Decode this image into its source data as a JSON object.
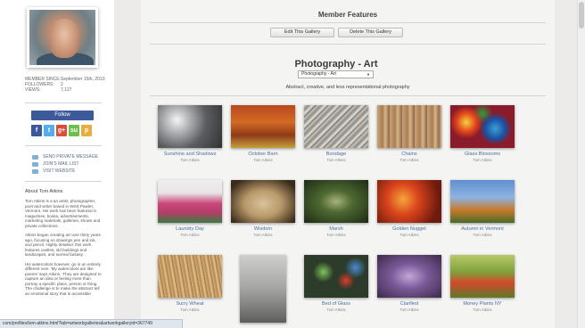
{
  "profile": {
    "stats": [
      {
        "label": "MEMBER SINCE:",
        "value": "September 15th, 2013"
      },
      {
        "label": "FOLLOWERS:",
        "value": "2"
      },
      {
        "label": "VIEWS:",
        "value": "7,127"
      }
    ],
    "follow_label": "Follow",
    "social": [
      {
        "icon": "facebook-icon",
        "glyph": "f",
        "color": "#3b5998"
      },
      {
        "icon": "twitter-icon",
        "glyph": "t",
        "color": "#55acee"
      },
      {
        "icon": "googleplus-icon",
        "glyph": "g+",
        "color": "#dd4b39"
      },
      {
        "icon": "stumbleupon-icon",
        "glyph": "su",
        "color": "#6fbf4c"
      },
      {
        "icon": "pinterest-icon",
        "glyph": "p",
        "color": "#e8ad3f"
      }
    ],
    "links": [
      "SEND PRIVATE MESSAGE",
      "JOIN'S MAIL LIST",
      "VISIT WEBSITE"
    ],
    "about_title": "About Tom Atkins",
    "about_paragraphs": [
      "Tom Atkins is a an artist, photographer, poet and writer based in West Pawlet, Vermont. His work has been featured in magazines, books, advertisements, marketing materials, galleries, shows and private collections.",
      "Atkins began creating art over thirty years ago, focusing on drawings pen and ink, and pencil. Highly detailed, this work features castles, old buildings and landscapes, and surreal fantasy.",
      "His watercolors however, go in an entirely different vein. 'My watercolors are like poems' says Atkins. 'They are designed to capture an idea or feeling more than portray a specific place, person or thing. The challenge is to make the abstract tell an emotional story that is accessible"
    ]
  },
  "main": {
    "section_title": "Member Features",
    "edit_button": "Edit This Gallery",
    "delete_button": "Delete This Gallery",
    "gallery_title": "Photography - Art",
    "gallery_select_value": "Photography - Art",
    "gallery_description": "Abstract, creative, and less representational photography",
    "artworks": [
      {
        "title": "Sunshine and Shadows",
        "author": "Tom Atkins"
      },
      {
        "title": "October Barn",
        "author": "Tom Atkins"
      },
      {
        "title": "Bondage",
        "author": "Tom Atkins"
      },
      {
        "title": "Chains",
        "author": "Tom Atkins"
      },
      {
        "title": "Glass Blossoms",
        "author": "Tom Atkins"
      },
      {
        "title": "Laundry Day",
        "author": "Tom Atkins"
      },
      {
        "title": "Wisdom",
        "author": "Tom Atkins"
      },
      {
        "title": "Marsh",
        "author": "Tom Atkins"
      },
      {
        "title": "Golden Nugget",
        "author": "Tom Atkins"
      },
      {
        "title": "Autumn in Vermont",
        "author": "Tom Atkins"
      },
      {
        "title": "Surry Wheat",
        "author": "Tom Atkins"
      },
      {
        "title": "",
        "author": ""
      },
      {
        "title": "Bed of Glass",
        "author": "Tom Atkins"
      },
      {
        "title": "Clarified",
        "author": "Tom Atkins"
      },
      {
        "title": "Money Plants NY",
        "author": "Tom Atkins"
      }
    ]
  },
  "status_url": "com/profiles/tom-atkins.html?tab=artworkgalleries&artworkgalleryid=367749"
}
